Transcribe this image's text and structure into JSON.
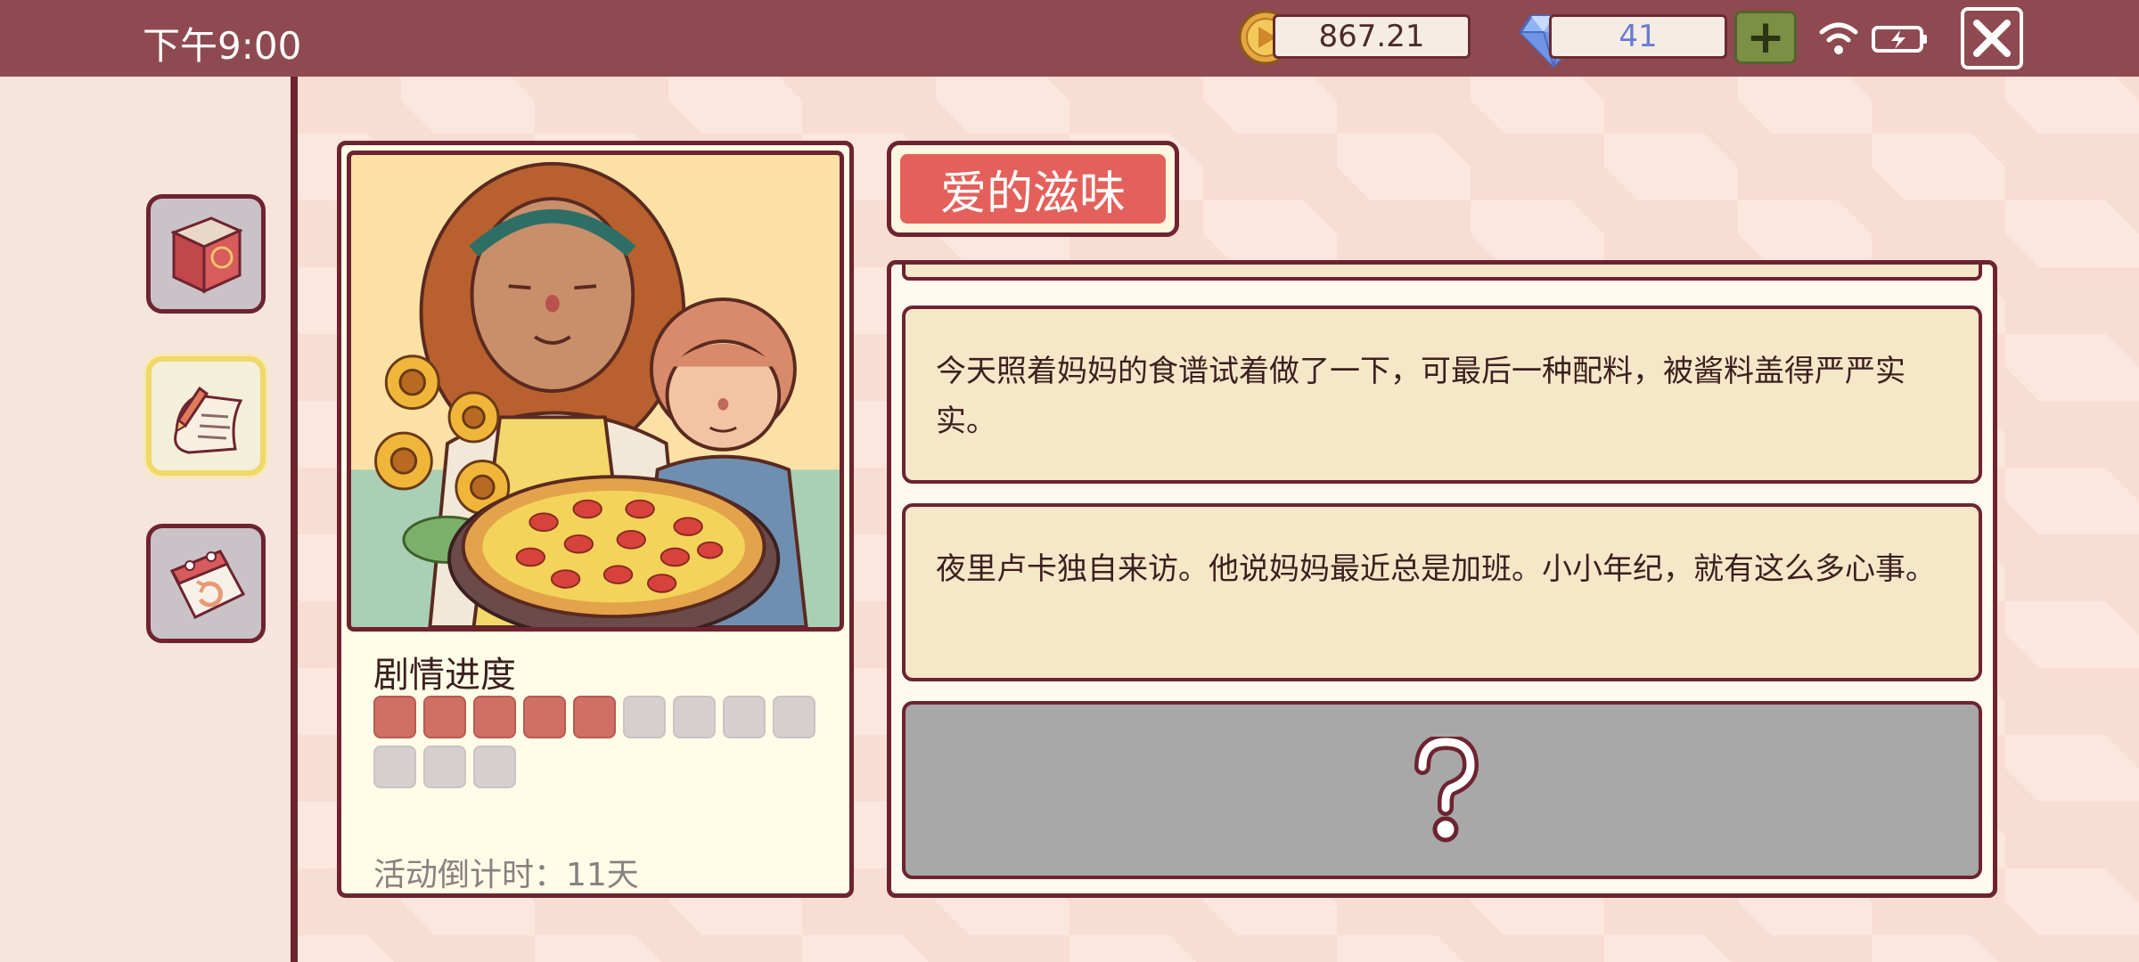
{
  "status": {
    "time": "下午9:00"
  },
  "currency": {
    "coins": "867.21",
    "gems": "41",
    "add_label": "+"
  },
  "sidebar": {
    "items": [
      {
        "icon": "recipe-book-icon",
        "active": false
      },
      {
        "icon": "diary-scroll-icon",
        "active": true
      },
      {
        "icon": "calendar-rewind-icon",
        "active": false
      }
    ]
  },
  "card": {
    "progress_title": "剧情进度",
    "progress": {
      "filled": 5,
      "total": 12
    },
    "countdown": "活动倒计时：11天"
  },
  "story": {
    "title": "爱的滋味",
    "entries": [
      "今天照着妈妈的食谱试着做了一下，可最后一种配料，被酱料盖得严严实实。",
      "夜里卢卡独自来访。他说妈妈最近总是加班。小小年纪，就有这么多心事。"
    ],
    "locked_symbol": "?"
  },
  "colors": {
    "topbar": "#8e4a50",
    "border": "#6e2330",
    "title_red": "#e4605a",
    "progress_filled": "#d06f63",
    "progress_empty": "#d7cfcf",
    "plus_green": "#7b8f45"
  }
}
